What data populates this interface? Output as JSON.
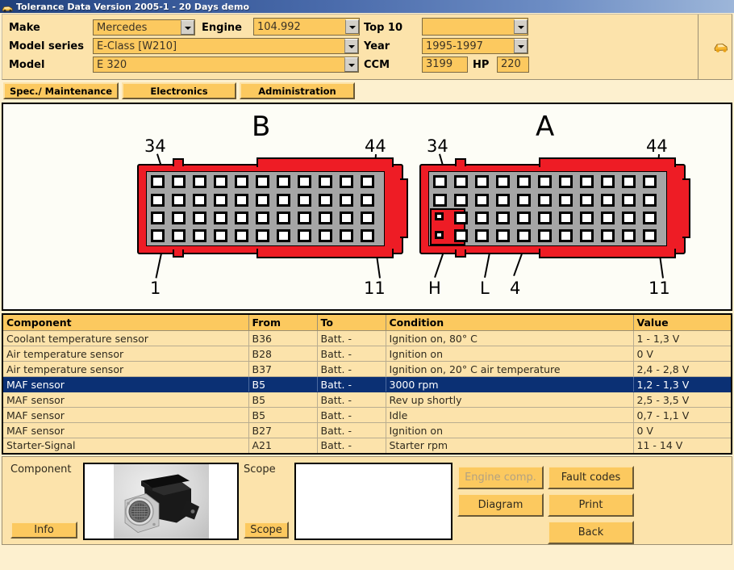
{
  "window": {
    "title": "Tolerance Data Version 2005-1 - 20 Days demo",
    "icon": "car-icon"
  },
  "selectors": {
    "make": {
      "label": "Make",
      "value": "Mercedes"
    },
    "model_series": {
      "label": "Model series",
      "value": "E-Class [W210]"
    },
    "model": {
      "label": "Model",
      "value": "E 320"
    },
    "engine": {
      "label": "Engine",
      "value": "104.992"
    },
    "top10": {
      "label": "Top 10",
      "value": ""
    },
    "year": {
      "label": "Year",
      "value": "1995-1997"
    },
    "ccm": {
      "label": "CCM",
      "value": "3199"
    },
    "hp": {
      "label": "HP",
      "value": "220"
    }
  },
  "tabs": [
    {
      "label": "Spec./ Maintenance",
      "active": false
    },
    {
      "label": "Electronics",
      "active": true
    },
    {
      "label": "Administration",
      "active": false
    }
  ],
  "diagram": {
    "connectors": [
      {
        "name": "B",
        "label": "B",
        "pin_labels": {
          "top_left": "34",
          "top_right": "44",
          "bottom_left": "1",
          "bottom_right": "11"
        },
        "rows": 4,
        "cols": 11,
        "highlight": null
      },
      {
        "name": "A",
        "label": "A",
        "pin_labels": {
          "top_left": "34",
          "top_right": "44",
          "bottom_left_h": "H",
          "bottom_left_l": "L",
          "bottom_mid": "4",
          "bottom_right": "11"
        },
        "rows": 4,
        "cols": 11,
        "highlight": {
          "row_start": 3,
          "row_end": 4,
          "col": 1,
          "color": "#ee1c25"
        }
      }
    ]
  },
  "table": {
    "columns": [
      "Component",
      "From",
      "To",
      "Condition",
      "Value"
    ],
    "rows": [
      {
        "component": "Coolant temperature sensor",
        "from": "B36",
        "to": "Batt. -",
        "condition": "Ignition on, 80° C",
        "value": "1 - 1,3 V",
        "selected": false
      },
      {
        "component": "Air temperature sensor",
        "from": "B28",
        "to": "Batt. -",
        "condition": "Ignition on",
        "value": "0 V",
        "selected": false
      },
      {
        "component": "Air temperature sensor",
        "from": "B37",
        "to": "Batt. -",
        "condition": "Ignition on, 20° C air temperature",
        "value": "2,4 - 2,8 V",
        "selected": false
      },
      {
        "component": "MAF sensor",
        "from": "B5",
        "to": "Batt. -",
        "condition": "3000 rpm",
        "value": "1,2 - 1,3 V",
        "selected": true
      },
      {
        "component": "MAF sensor",
        "from": "B5",
        "to": "Batt. -",
        "condition": "Rev up shortly",
        "value": "2,5  - 3,5 V",
        "selected": false
      },
      {
        "component": "MAF sensor",
        "from": "B5",
        "to": "Batt. -",
        "condition": "Idle",
        "value": "0,7 - 1,1 V",
        "selected": false
      },
      {
        "component": "MAF sensor",
        "from": "B27",
        "to": "Batt. -",
        "condition": "Ignition on",
        "value": "0 V",
        "selected": false
      },
      {
        "component": "Starter-Signal",
        "from": "A21",
        "to": "Batt. -",
        "condition": "Starter rpm",
        "value": "11 - 14 V",
        "selected": false
      }
    ]
  },
  "bottom": {
    "component_label": "Component",
    "component_image": "maf-sensor-photo",
    "info_button": "Info",
    "scope_label": "Scope",
    "scope_button": "Scope",
    "buttons": [
      {
        "label": "Engine comp.",
        "disabled": true
      },
      {
        "label": "Diagram",
        "disabled": false
      },
      {
        "label": "Fault codes",
        "disabled": false
      },
      {
        "label": "Print",
        "disabled": false
      },
      {
        "label": "Back",
        "disabled": false
      }
    ]
  },
  "colors": {
    "titlebar_start": "#1f3f79",
    "titlebar_end": "#9db6d9",
    "panel_bg": "#fce3ab",
    "field_bg": "#fcc95f",
    "page_bg": "#fdf0cf",
    "selection": "#0b3074",
    "connector_red": "#ee1c25",
    "connector_grey": "#a5a5a5"
  }
}
